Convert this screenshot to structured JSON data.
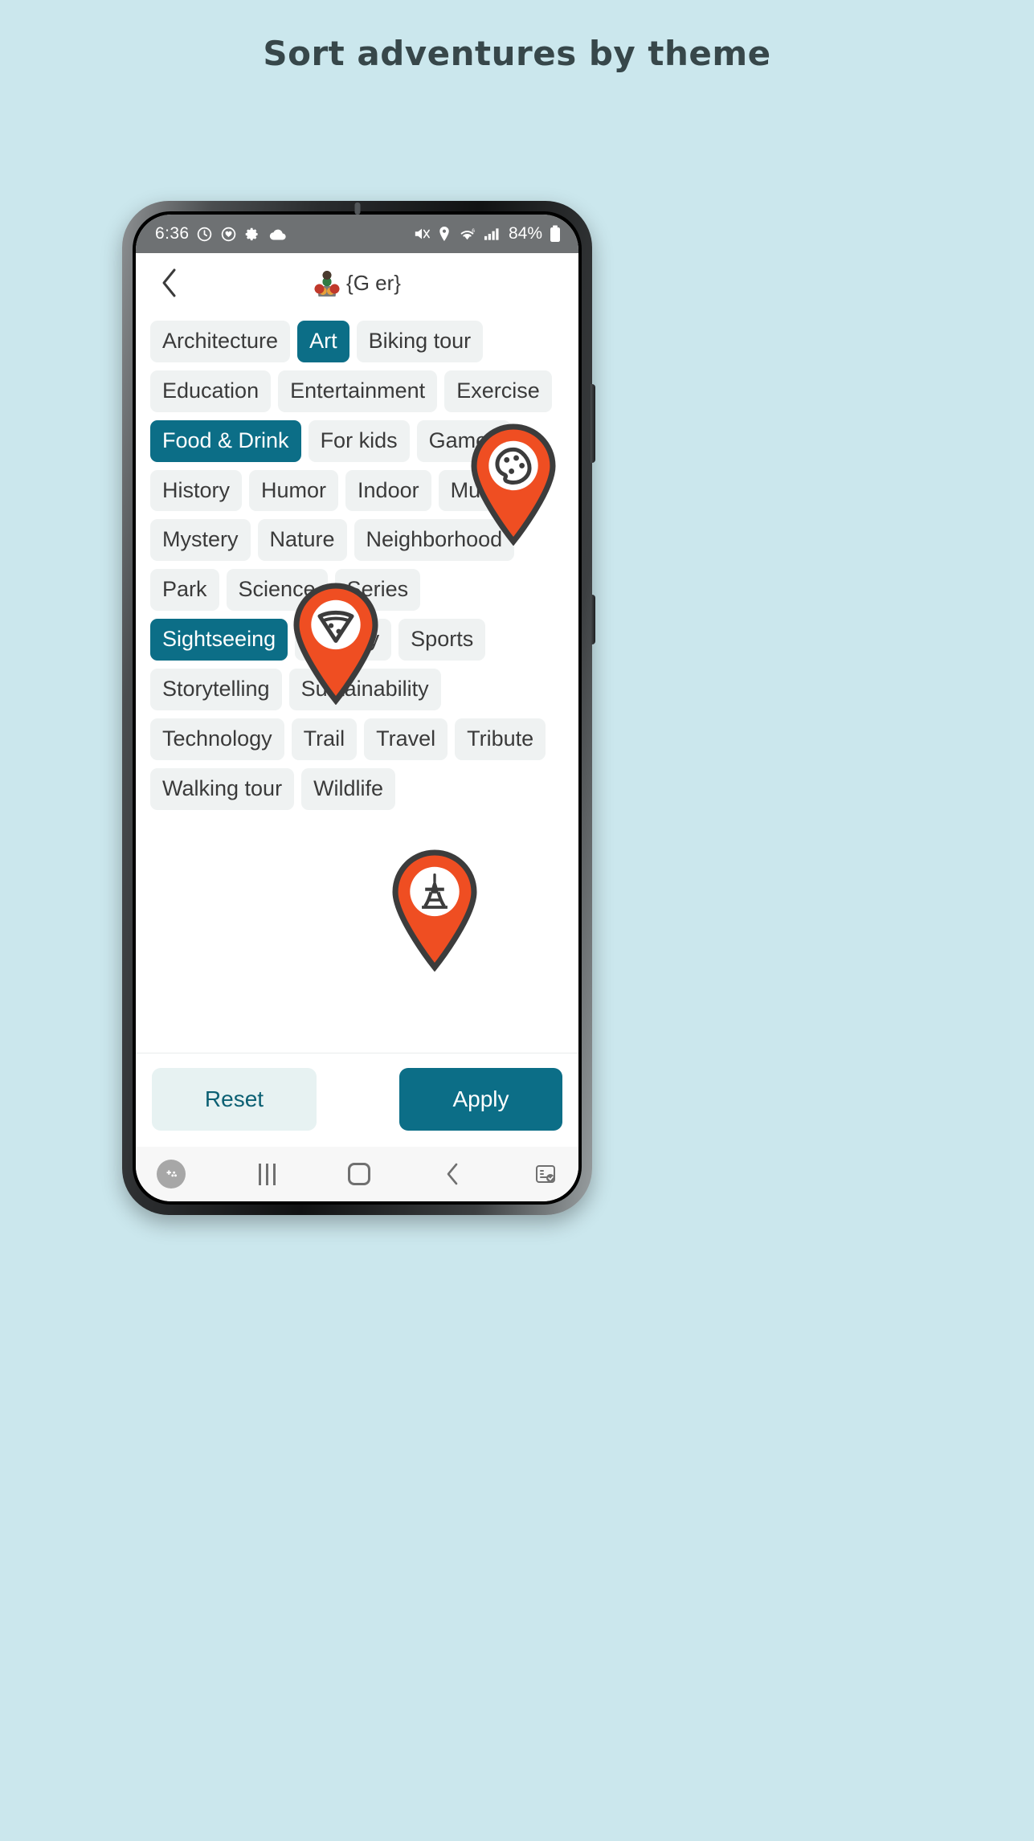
{
  "headline": "Sort adventures by theme",
  "colors": {
    "background": "#cbe7ed",
    "accent_teal": "#0c6e87",
    "accent_orange": "#ef4e22",
    "chip_bg": "#eff2f2",
    "reset_bg": "#e7f2f2",
    "text_dark": "#3a3a3a"
  },
  "phone": {
    "statusbar": {
      "time": "6:36",
      "battery": "84%",
      "left_icons": [
        "alarm-icon",
        "heart-icon",
        "gear-icon",
        "cloud-icon"
      ],
      "right_icons": [
        "mute-icon",
        "location-icon",
        "wifi-icon",
        "signal-icon",
        "battery-icon"
      ]
    },
    "appbar": {
      "back_icon": "chevron-left-icon",
      "title_emoji": "family-icon",
      "title": "{G            er}"
    },
    "chips": [
      {
        "label": "Architecture",
        "selected": false
      },
      {
        "label": "Art",
        "selected": true
      },
      {
        "label": "Biking tour",
        "selected": false
      },
      {
        "label": "Education",
        "selected": false
      },
      {
        "label": "Entertainment",
        "selected": false
      },
      {
        "label": "Exercise",
        "selected": false
      },
      {
        "label": "Food & Drink",
        "selected": true
      },
      {
        "label": "For kids",
        "selected": false
      },
      {
        "label": "Games",
        "selected": false
      },
      {
        "label": "History",
        "selected": false
      },
      {
        "label": "Humor",
        "selected": false
      },
      {
        "label": "Indoor",
        "selected": false
      },
      {
        "label": "Music",
        "selected": false
      },
      {
        "label": "Mystery",
        "selected": false
      },
      {
        "label": "Nature",
        "selected": false
      },
      {
        "label": "Neighborhood",
        "selected": false
      },
      {
        "label": "Park",
        "selected": false
      },
      {
        "label": "Science",
        "selected": false
      },
      {
        "label": "Series",
        "selected": false
      },
      {
        "label": "Sightseeing",
        "selected": true
      },
      {
        "label": "Spooky",
        "selected": false
      },
      {
        "label": "Sports",
        "selected": false
      },
      {
        "label": "Storytelling",
        "selected": false
      },
      {
        "label": "Sustainability",
        "selected": false
      },
      {
        "label": "Technology",
        "selected": false
      },
      {
        "label": "Trail",
        "selected": false
      },
      {
        "label": "Travel",
        "selected": false
      },
      {
        "label": "Tribute",
        "selected": false
      },
      {
        "label": "Walking tour",
        "selected": false
      },
      {
        "label": "Wildlife",
        "selected": false
      }
    ],
    "footer": {
      "reset_label": "Reset",
      "apply_label": "Apply"
    },
    "navbar": {
      "game_icon": "game-launcher-icon",
      "recents_icon": "recents-icon",
      "home_icon": "home-icon",
      "back_icon": "back-icon",
      "keyboard_icon": "keyboard-switch-icon"
    }
  },
  "pins": [
    {
      "id": "pin-art",
      "icon": "palette-icon"
    },
    {
      "id": "pin-food",
      "icon": "pizza-icon"
    },
    {
      "id": "pin-sights",
      "icon": "eiffel-tower-icon"
    }
  ]
}
